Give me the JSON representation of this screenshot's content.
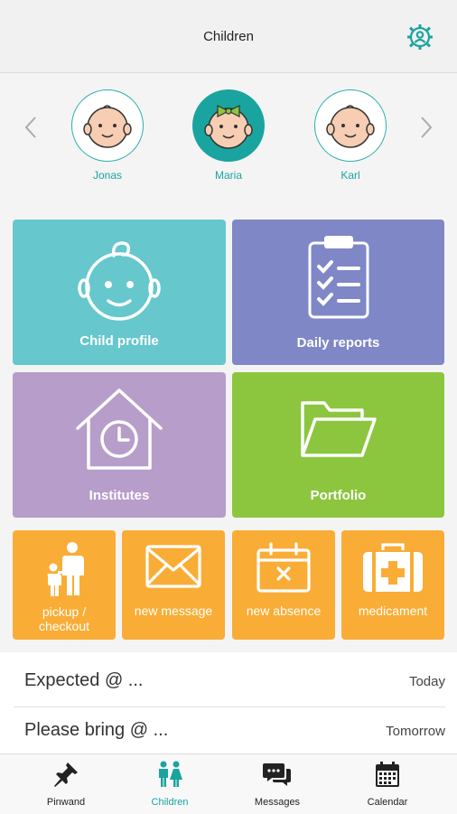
{
  "header": {
    "title": "Children"
  },
  "children": [
    {
      "name": "Jonas",
      "selected": false
    },
    {
      "name": "Maria",
      "selected": true
    },
    {
      "name": "Karl",
      "selected": false
    }
  ],
  "tiles": {
    "child_profile": "Child profile",
    "daily_reports": "Daily reports",
    "institutes": "Institutes",
    "portfolio": "Portfolio",
    "pickup_line1": "pickup /",
    "pickup_line2": "checkout",
    "new_message": "new message",
    "new_absence": "new absence",
    "medicament": "medicament"
  },
  "list": [
    {
      "label": "Expected @ ...",
      "when": "Today"
    },
    {
      "label": "Please bring @ ...",
      "when": "Tomorrow"
    }
  ],
  "nav": [
    {
      "label": "Pinwand"
    },
    {
      "label": "Children",
      "active": true
    },
    {
      "label": "Messages"
    },
    {
      "label": "Calendar"
    }
  ],
  "colors": {
    "accent": "#1aa49f",
    "tile_child_profile": "#66c7cc",
    "tile_daily_reports": "#7f87c6",
    "tile_institutes": "#b79dca",
    "tile_portfolio": "#8cc63f",
    "tile_small": "#f9ad36"
  },
  "icons": {
    "settings": "gear-icon",
    "prev": "chevron-left-icon",
    "next": "chevron-right-icon"
  }
}
